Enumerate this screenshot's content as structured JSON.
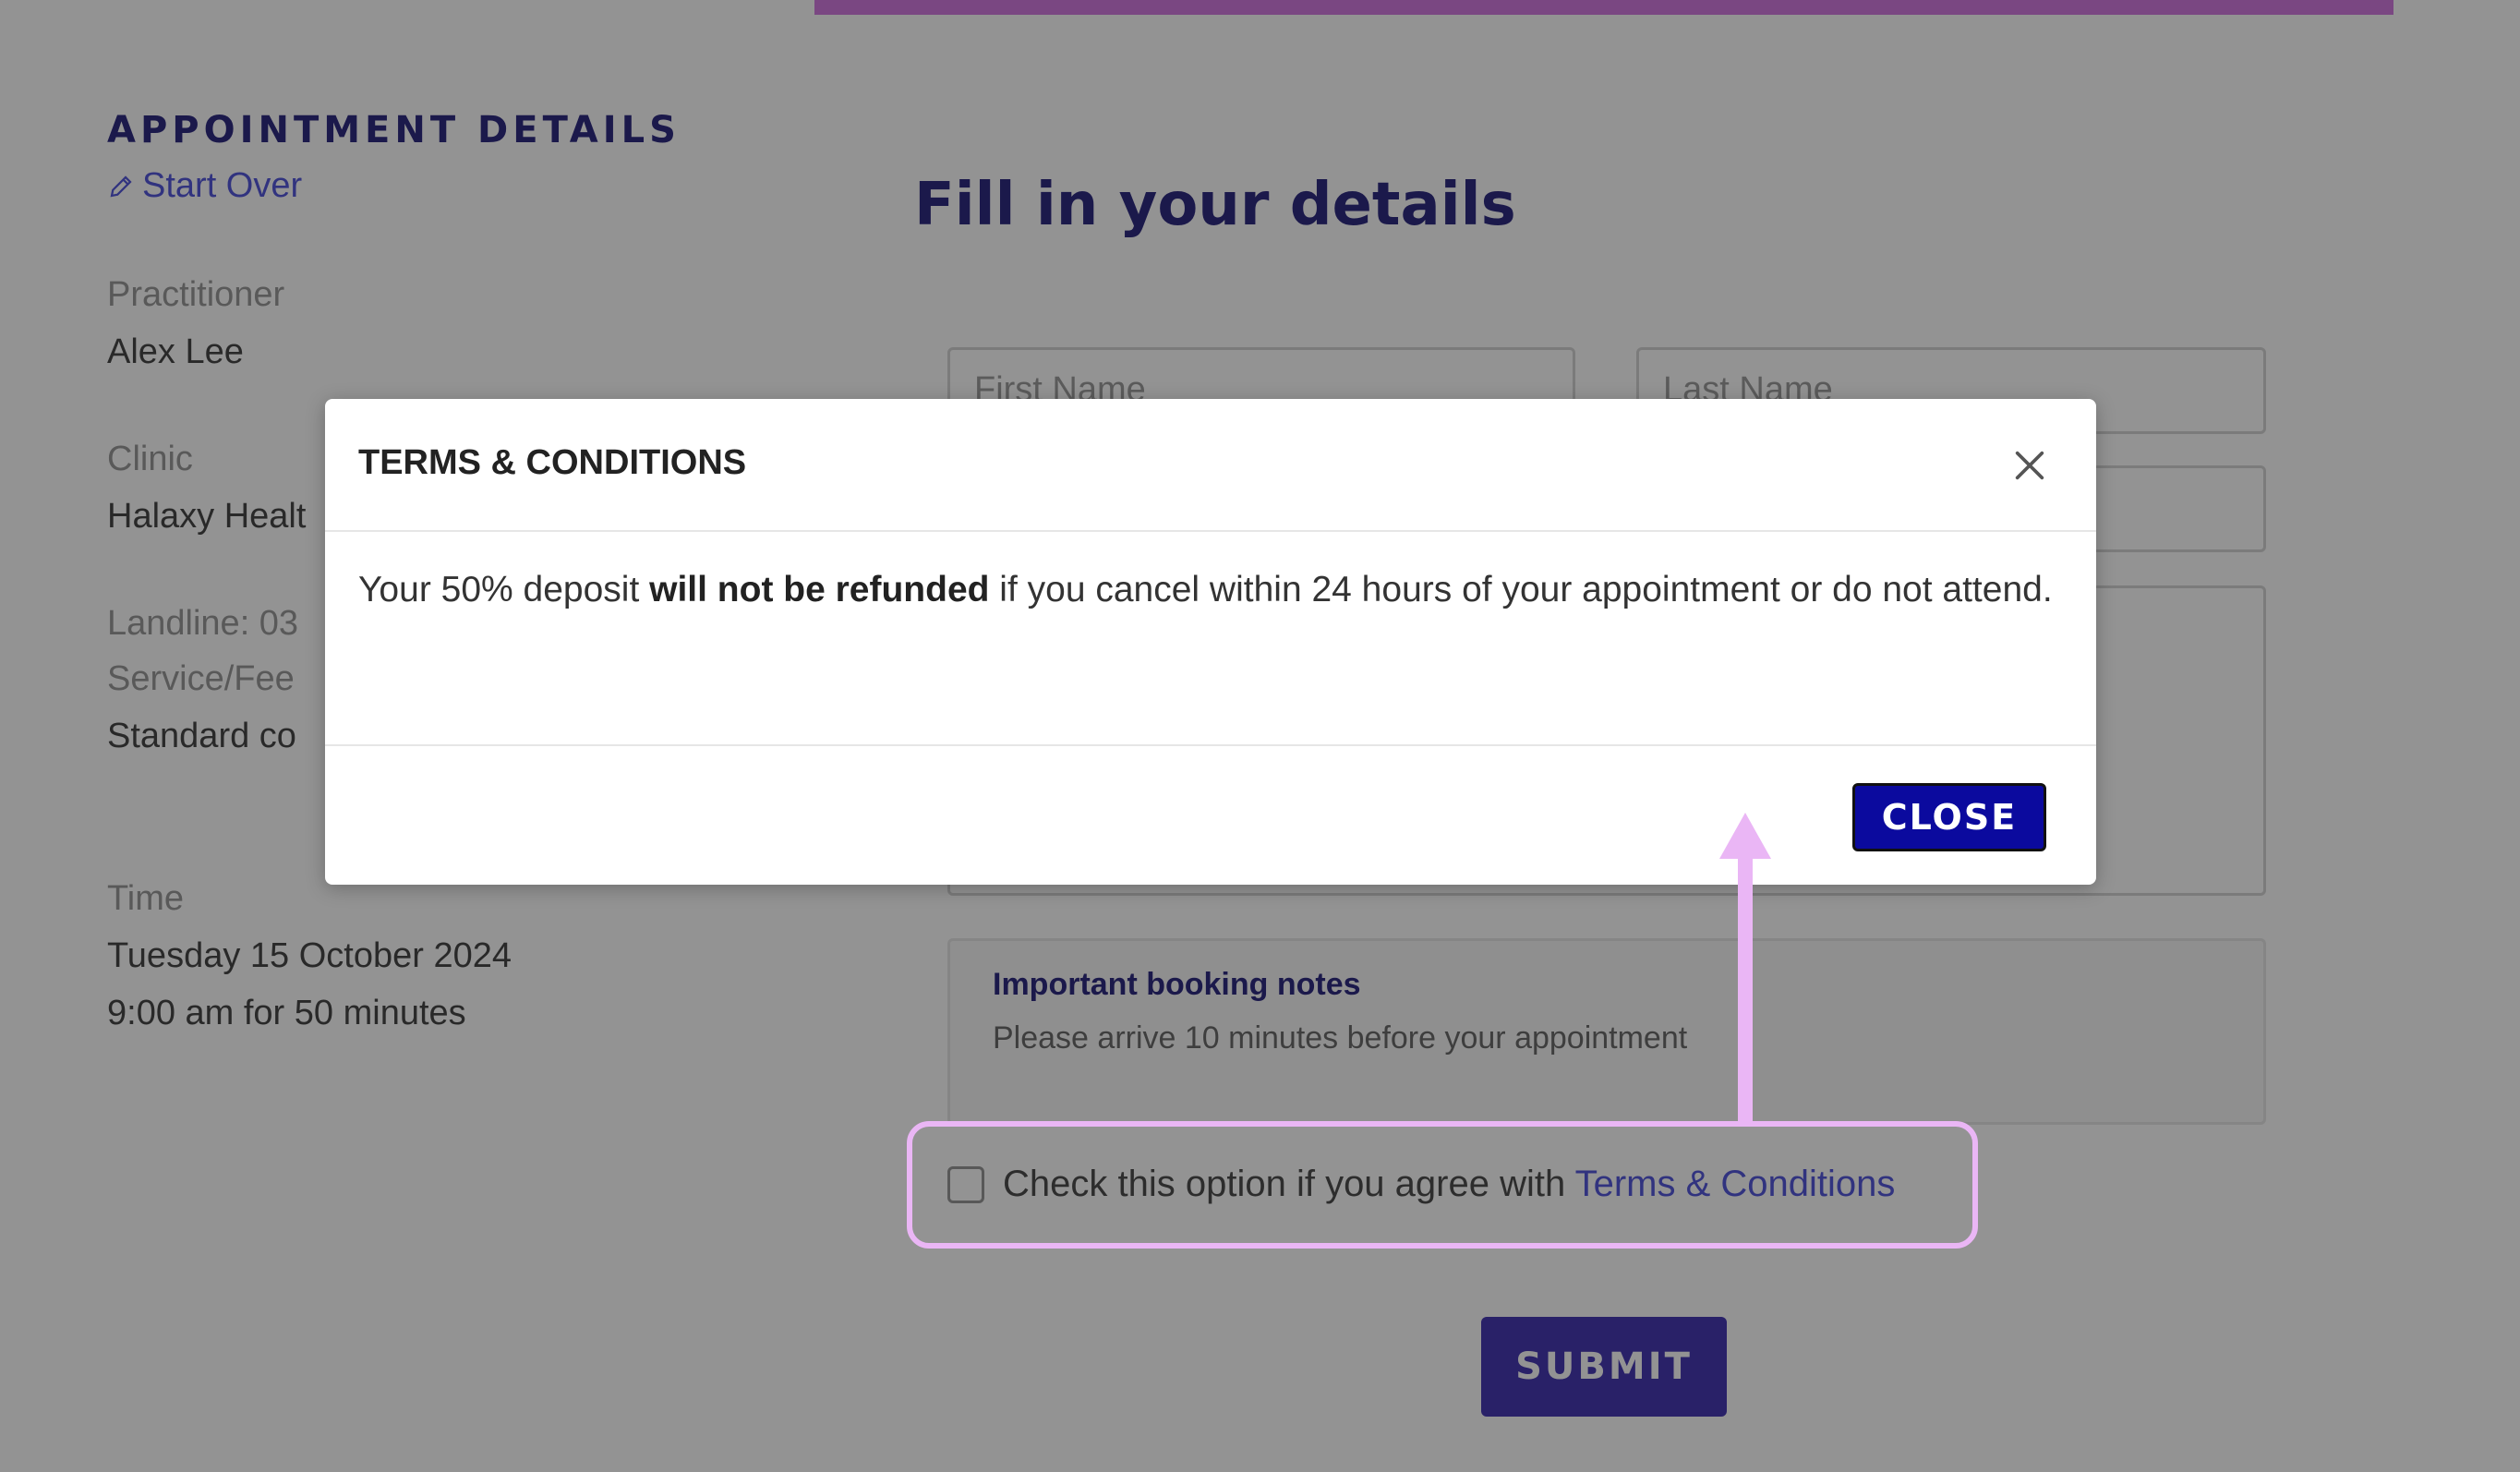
{
  "sidebar": {
    "heading": "APPOINTMENT DETAILS",
    "start_over": "Start Over",
    "practitioner_label": "Practitioner",
    "practitioner_value": "Alex Lee",
    "clinic_label": "Clinic",
    "clinic_value": "Halaxy Healt",
    "landline": "Landline: 03",
    "service_label": "Service/Fee",
    "service_value": "Standard co",
    "time_label": "Time",
    "time_date": "Tuesday 15 October 2024",
    "time_duration": "9:00 am for 50 minutes"
  },
  "form": {
    "title": "Fill in your details",
    "first_name_placeholder": "First Name",
    "last_name_placeholder": "Last Name",
    "notes_title": "Important booking notes",
    "notes_body": "Please arrive 10 minutes before your appointment",
    "agree_text": "Check this option if you agree with ",
    "terms_link": "Terms & Conditions",
    "submit": "SUBMIT"
  },
  "modal": {
    "title": "TERMS & CONDITIONS",
    "body_pre": "Your 50% deposit ",
    "body_bold": "will not be refunded",
    "body_post": " if you cancel within 24 hours of your appointment or do not attend.",
    "close": "CLOSE"
  },
  "colors": {
    "accent": "#0f0a6e",
    "link": "#3a3fd6",
    "top_bar": "#cc66dd",
    "annotation": "#eab6f5"
  }
}
